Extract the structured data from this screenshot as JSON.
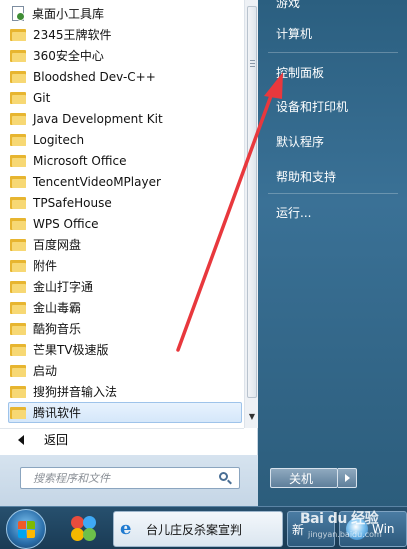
{
  "program_list": {
    "items": [
      {
        "label": "桌面小工具库",
        "icon": "gadget-icon"
      },
      {
        "label": "2345王牌软件",
        "icon": "folder-icon"
      },
      {
        "label": "360安全中心",
        "icon": "folder-icon"
      },
      {
        "label": "Bloodshed Dev-C++",
        "icon": "folder-icon"
      },
      {
        "label": "Git",
        "icon": "folder-icon"
      },
      {
        "label": "Java Development Kit",
        "icon": "folder-icon"
      },
      {
        "label": "Logitech",
        "icon": "folder-icon"
      },
      {
        "label": "Microsoft Office",
        "icon": "folder-icon"
      },
      {
        "label": "TencentVideoMPlayer",
        "icon": "folder-icon"
      },
      {
        "label": "TPSafeHouse",
        "icon": "folder-icon"
      },
      {
        "label": "WPS Office",
        "icon": "folder-icon"
      },
      {
        "label": "百度网盘",
        "icon": "folder-icon"
      },
      {
        "label": "附件",
        "icon": "folder-icon"
      },
      {
        "label": "金山打字通",
        "icon": "folder-icon"
      },
      {
        "label": "金山毒霸",
        "icon": "folder-icon"
      },
      {
        "label": "酷狗音乐",
        "icon": "folder-icon"
      },
      {
        "label": "芒果TV极速版",
        "icon": "folder-icon"
      },
      {
        "label": "启动",
        "icon": "folder-icon"
      },
      {
        "label": "搜狗拼音输入法",
        "icon": "folder-icon"
      },
      {
        "label": "腾讯软件",
        "icon": "folder-icon",
        "selected": true
      }
    ]
  },
  "back": {
    "label": "返回"
  },
  "search": {
    "placeholder": "搜索程序和文件"
  },
  "right_pane": {
    "items": [
      {
        "label": "游戏"
      },
      {
        "label": "计算机"
      },
      {
        "label": "控制面板"
      },
      {
        "label": "设备和打印机"
      },
      {
        "label": "默认程序"
      },
      {
        "label": "帮助和支持"
      },
      {
        "label": "运行..."
      }
    ]
  },
  "shutdown": {
    "label": "关机"
  },
  "taskbar": {
    "window_title": "台儿庄反杀案宣判",
    "window2_label": "新",
    "window3_label": "Win"
  },
  "watermark": {
    "text": "Bai du 经验",
    "sub": "jingyan.baidu.com"
  },
  "colors": {
    "annotation_arrow": "#e8383d",
    "selection": "#d5e7fa"
  }
}
